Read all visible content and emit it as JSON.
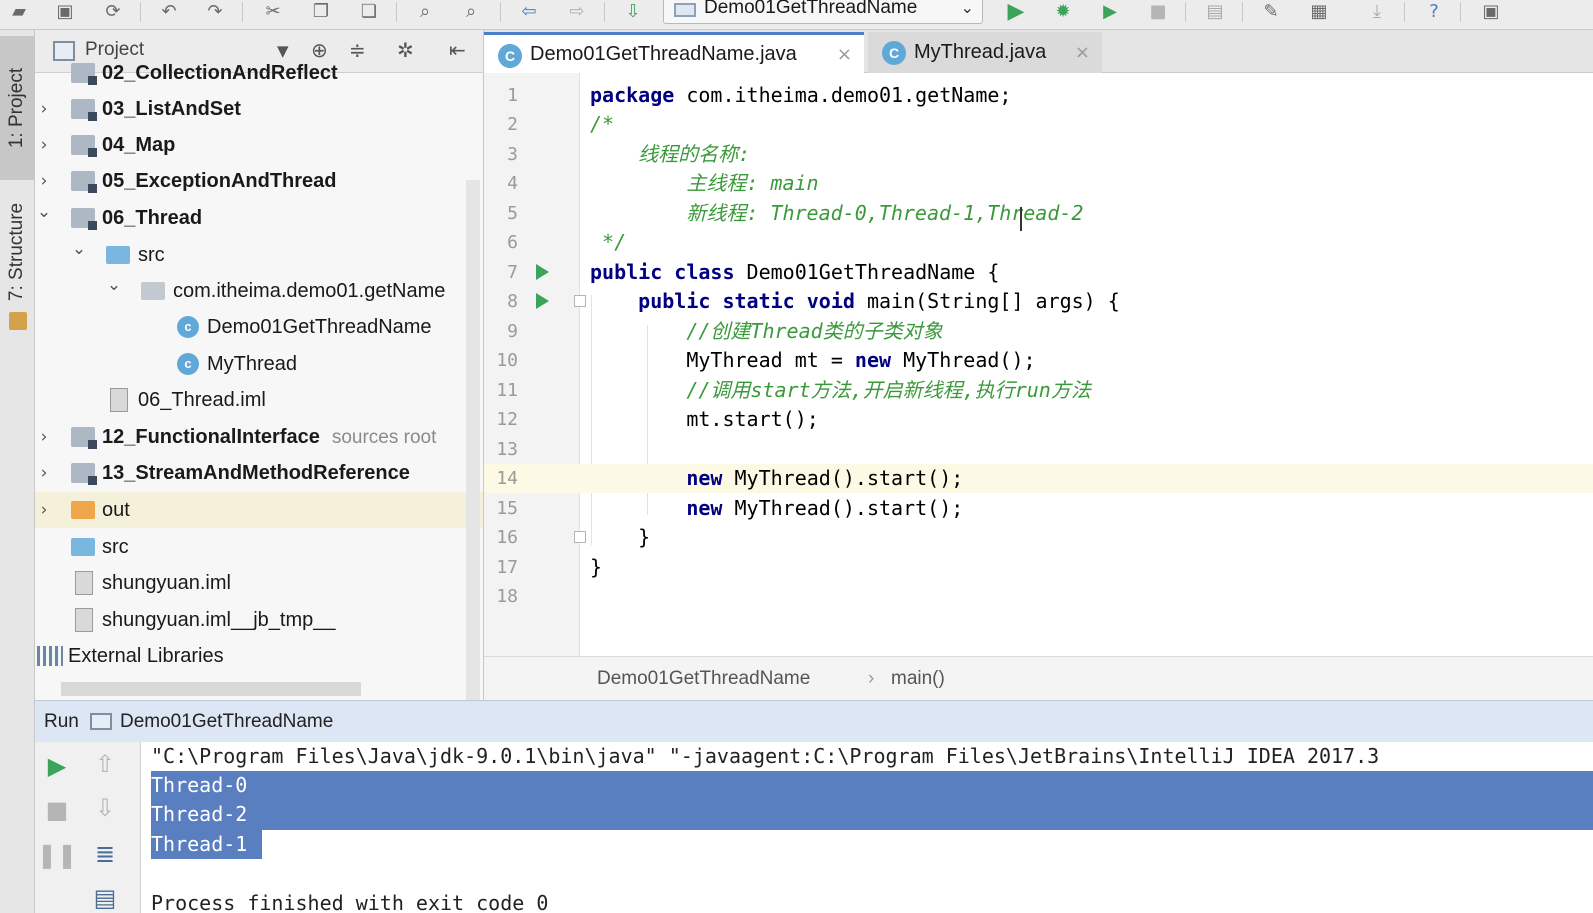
{
  "toolbar": {
    "run_config": "Demo01GetThreadName"
  },
  "left_tool_tabs": {
    "project": "1: Project",
    "structure": "7: Structure"
  },
  "project_panel": {
    "title": "Project",
    "tree": [
      {
        "label": "02_CollectionAndReflect",
        "bold": true
      },
      {
        "label": "03_ListAndSet",
        "bold": true,
        "expander": "›"
      },
      {
        "label": "04_Map",
        "bold": true,
        "expander": "›"
      },
      {
        "label": "05_ExceptionAndThread",
        "bold": true,
        "expander": "›"
      },
      {
        "label": "06_Thread",
        "bold": true,
        "expander": "⌄"
      },
      {
        "label": "src",
        "expander": "⌄"
      },
      {
        "label": "com.itheima.demo01.getName",
        "expander": "⌄"
      },
      {
        "label": "Demo01GetThreadName"
      },
      {
        "label": "MyThread"
      },
      {
        "label": "06_Thread.iml"
      },
      {
        "label": "12_FunctionalInterface",
        "bold": true,
        "extra": "sources root",
        "expander": "›"
      },
      {
        "label": "13_StreamAndMethodReference",
        "bold": true,
        "expander": "›"
      },
      {
        "label": "out",
        "expander": "›"
      },
      {
        "label": "src"
      },
      {
        "label": "shungyuan.iml"
      },
      {
        "label": "shungyuan.iml__jb_tmp__"
      },
      {
        "label": "External Libraries"
      }
    ]
  },
  "editor": {
    "tabs": [
      {
        "label": "Demo01GetThreadName.java",
        "icon": "C",
        "close": "×"
      },
      {
        "label": "MyThread.java",
        "icon": "C",
        "close": "×"
      }
    ],
    "line_numbers": [
      "1",
      "2",
      "3",
      "4",
      "5",
      "6",
      "7",
      "8",
      "9",
      "10",
      "11",
      "12",
      "13",
      "14",
      "15",
      "16",
      "17",
      "18"
    ],
    "code": {
      "l1_kw": "package",
      "l1_rest": " com.itheima.demo01.getName;",
      "l2": "/*",
      "l3": "    线程的名称:",
      "l4": "        主线程: main",
      "l5": "        新线程: Thread-0,Thread-1,Thread-2",
      "l6": " */",
      "l7_kw": "public class",
      "l7_rest": " Demo01GetThreadName {",
      "l8_kw": "    public static void",
      "l8_rest": " main(String[] args) {",
      "l9": "        //创建Thread类的子类对象",
      "l10_a": "        MyThread mt = ",
      "l10_kw": "new",
      "l10_b": " MyThread();",
      "l11": "        //调用start方法,开启新线程,执行run方法",
      "l12": "        mt.start();",
      "l14_kw": "        new",
      "l14_rest": " MyThread().start();",
      "l15_kw": "        new",
      "l15_rest": " MyThread().start();",
      "l16": "    }",
      "l17": "}"
    }
  },
  "breadcrumb": {
    "class_name": "Demo01GetThreadName",
    "separator": "›",
    "method": "main()"
  },
  "run_panel": {
    "title": "Run",
    "config": "Demo01GetThreadName",
    "console_lines": [
      "\"C:\\Program Files\\Java\\jdk-9.0.1\\bin\\java\" \"-javaagent:C:\\Program Files\\JetBrains\\IntelliJ IDEA 2017.3",
      "Thread-0",
      "Thread-2",
      "Thread-1",
      "",
      "Process finished with exit code 0"
    ]
  },
  "colors": {
    "keyword": "#000080",
    "comment": "#3a9a3a",
    "selection": "#5a7fc0",
    "run_green": "#3ba35a"
  }
}
